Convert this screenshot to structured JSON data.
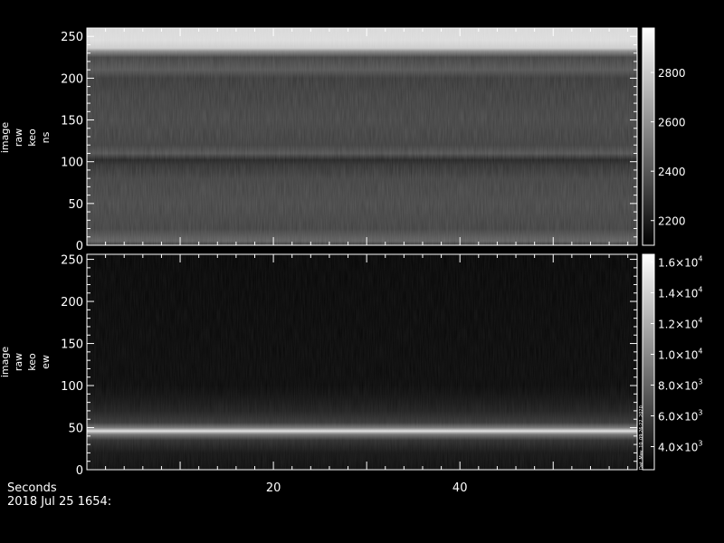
{
  "chart_data": [
    {
      "type": "heatmap",
      "ylabel_lines": [
        "image",
        "raw",
        "keo",
        "ns"
      ],
      "ylim": [
        0,
        260
      ],
      "yticks": [
        "0",
        "50",
        "100",
        "150",
        "200",
        "250"
      ],
      "xlim": [
        0,
        59
      ],
      "colorbar": {
        "range": [
          2100,
          2980
        ],
        "ticks": [
          "2200",
          "2400",
          "2600",
          "2800"
        ],
        "tick_values": [
          2200,
          2400,
          2600,
          2800
        ]
      },
      "row_profile": [
        {
          "y": 0,
          "v": 2260
        },
        {
          "y": 5,
          "v": 2420
        },
        {
          "y": 20,
          "v": 2310
        },
        {
          "y": 50,
          "v": 2330
        },
        {
          "y": 80,
          "v": 2310
        },
        {
          "y": 96,
          "v": 2250
        },
        {
          "y": 102,
          "v": 2200
        },
        {
          "y": 110,
          "v": 2370
        },
        {
          "y": 120,
          "v": 2300
        },
        {
          "y": 150,
          "v": 2320
        },
        {
          "y": 180,
          "v": 2300
        },
        {
          "y": 200,
          "v": 2280
        },
        {
          "y": 210,
          "v": 2380
        },
        {
          "y": 225,
          "v": 2310
        },
        {
          "y": 232,
          "v": 2560
        },
        {
          "y": 236,
          "v": 2820
        },
        {
          "y": 245,
          "v": 2880
        },
        {
          "y": 256,
          "v": 2870
        }
      ]
    },
    {
      "type": "heatmap",
      "ylabel_lines": [
        "image",
        "raw",
        "keo",
        "ew"
      ],
      "ylim": [
        0,
        256
      ],
      "yticks": [
        "0",
        "50",
        "100",
        "150",
        "200",
        "250"
      ],
      "xlim": [
        0,
        59
      ],
      "xticks": [
        "20",
        "40"
      ],
      "xtick_values": [
        20,
        40
      ],
      "colorbar": {
        "range": [
          2500,
          16500
        ],
        "ticks": [
          {
            "mant": "4.0",
            "exp": "3",
            "value": 4000
          },
          {
            "mant": "6.0",
            "exp": "3",
            "value": 6000
          },
          {
            "mant": "8.0",
            "exp": "3",
            "value": 8000
          },
          {
            "mant": "1.0",
            "exp": "4",
            "value": 10000
          },
          {
            "mant": "1.2",
            "exp": "4",
            "value": 12000
          },
          {
            "mant": "1.4",
            "exp": "4",
            "value": 14000
          },
          {
            "mant": "1.6",
            "exp": "4",
            "value": 16000
          }
        ],
        "tick_suffix": "×10"
      },
      "row_profile": [
        {
          "y": 0,
          "v": 3200
        },
        {
          "y": 20,
          "v": 3600
        },
        {
          "y": 35,
          "v": 5000
        },
        {
          "y": 42,
          "v": 9000
        },
        {
          "y": 46,
          "v": 15000
        },
        {
          "y": 50,
          "v": 9000
        },
        {
          "y": 56,
          "v": 5500
        },
        {
          "y": 70,
          "v": 4200
        },
        {
          "y": 85,
          "v": 3500
        },
        {
          "y": 100,
          "v": 3000
        },
        {
          "y": 256,
          "v": 2800
        }
      ],
      "side_text": "Dat_May_10_09:26:22_2020"
    }
  ],
  "footer": {
    "xaxis_label": "Seconds",
    "date_label": "2018 Jul 25 1654:"
  }
}
